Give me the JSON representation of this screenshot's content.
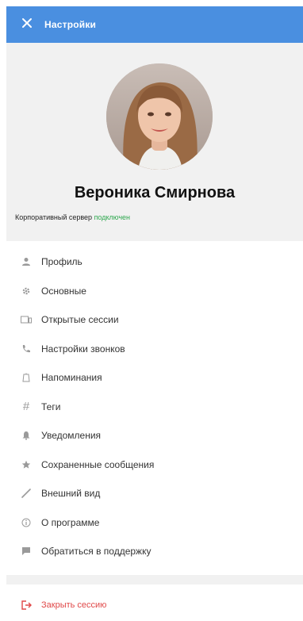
{
  "colors": {
    "header_bg": "#4a8fe0",
    "status_ok": "#2fa84f",
    "danger": "#e04848",
    "icon_gray": "#9a9a9a"
  },
  "header": {
    "title": "Настройки",
    "close_icon": "close-icon"
  },
  "profile": {
    "name": "Вероника Смирнова",
    "server_label": "Корпоративный сервер",
    "server_status": "подключен"
  },
  "menu": {
    "items": [
      {
        "label": "Профиль",
        "icon": "person-icon"
      },
      {
        "label": "Основные",
        "icon": "gear-icon"
      },
      {
        "label": "Открытые сессии",
        "icon": "devices-icon"
      },
      {
        "label": "Настройки звонков",
        "icon": "phone-icon"
      },
      {
        "label": "Напоминания",
        "icon": "reminder-icon"
      },
      {
        "label": "Теги",
        "icon": "hashtag-icon"
      },
      {
        "label": "Уведомления",
        "icon": "bell-icon"
      },
      {
        "label": "Сохраненные сообщения",
        "icon": "star-icon"
      },
      {
        "label": "Внешний вид",
        "icon": "brush-icon"
      },
      {
        "label": "О программе",
        "icon": "info-icon"
      },
      {
        "label": "Обратиться в поддержку",
        "icon": "chat-icon"
      }
    ]
  },
  "logout": {
    "label": "Закрыть сессию",
    "icon": "logout-icon"
  }
}
